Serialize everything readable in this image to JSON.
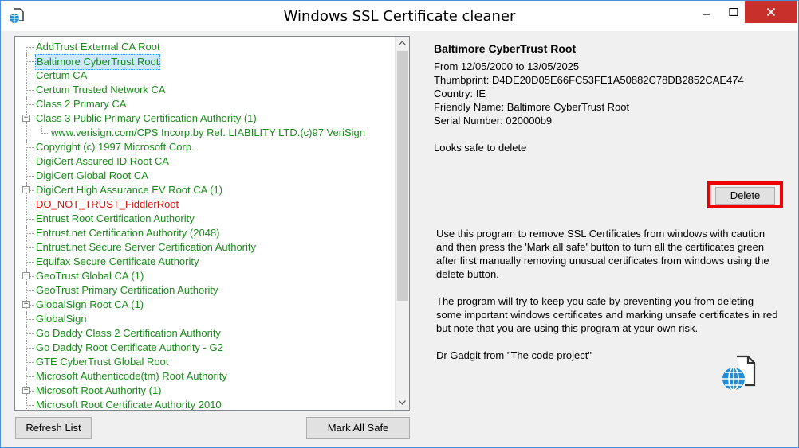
{
  "window": {
    "title": "Windows SSL Certificate cleaner"
  },
  "tree": {
    "items": [
      {
        "label": "AddTrust External CA Root",
        "color": "green",
        "expander": "",
        "level": 0
      },
      {
        "label": "Baltimore CyberTrust Root",
        "color": "green",
        "expander": "",
        "level": 0,
        "selected": true
      },
      {
        "label": "Certum CA",
        "color": "green",
        "expander": "",
        "level": 0
      },
      {
        "label": "Certum Trusted Network CA",
        "color": "green",
        "expander": "",
        "level": 0
      },
      {
        "label": "Class 2 Primary CA",
        "color": "green",
        "expander": "",
        "level": 0
      },
      {
        "label": "Class 3 Public Primary Certification Authority (1)",
        "color": "green",
        "expander": "−",
        "level": 0
      },
      {
        "label": "www.verisign.com/CPS Incorp.by Ref. LIABILITY LTD.(c)97 VeriSign",
        "color": "green",
        "expander": "",
        "level": 1
      },
      {
        "label": "Copyright (c) 1997 Microsoft Corp.",
        "color": "green",
        "expander": "",
        "level": 0
      },
      {
        "label": "DigiCert Assured ID Root CA",
        "color": "green",
        "expander": "",
        "level": 0
      },
      {
        "label": "DigiCert Global Root CA",
        "color": "green",
        "expander": "",
        "level": 0
      },
      {
        "label": "DigiCert High Assurance EV Root CA (1)",
        "color": "green",
        "expander": "+",
        "level": 0
      },
      {
        "label": "DO_NOT_TRUST_FiddlerRoot",
        "color": "red",
        "expander": "",
        "level": 0
      },
      {
        "label": "Entrust Root Certification Authority",
        "color": "green",
        "expander": "",
        "level": 0
      },
      {
        "label": "Entrust.net Certification Authority (2048)",
        "color": "green",
        "expander": "",
        "level": 0
      },
      {
        "label": "Entrust.net Secure Server Certification Authority",
        "color": "green",
        "expander": "",
        "level": 0
      },
      {
        "label": "Equifax Secure Certificate Authority",
        "color": "green",
        "expander": "",
        "level": 0
      },
      {
        "label": "GeoTrust Global CA (1)",
        "color": "green",
        "expander": "+",
        "level": 0
      },
      {
        "label": "GeoTrust Primary Certification Authority",
        "color": "green",
        "expander": "",
        "level": 0
      },
      {
        "label": "GlobalSign Root CA (1)",
        "color": "green",
        "expander": "+",
        "level": 0
      },
      {
        "label": "GlobalSign",
        "color": "green",
        "expander": "",
        "level": 0
      },
      {
        "label": "Go Daddy Class 2 Certification Authority",
        "color": "green",
        "expander": "",
        "level": 0
      },
      {
        "label": "Go Daddy Root Certificate Authority - G2",
        "color": "green",
        "expander": "",
        "level": 0
      },
      {
        "label": "GTE CyberTrust Global Root",
        "color": "green",
        "expander": "",
        "level": 0
      },
      {
        "label": "Microsoft Authenticode(tm) Root Authority",
        "color": "green",
        "expander": "",
        "level": 0
      },
      {
        "label": "Microsoft Root Authority (1)",
        "color": "green",
        "expander": "+",
        "level": 0
      },
      {
        "label": "Microsoft Root Certificate Authority 2010",
        "color": "green",
        "expander": "",
        "level": 0
      }
    ]
  },
  "buttons": {
    "refresh": "Refresh List",
    "mark_all_safe": "Mark All Safe",
    "delete": "Delete"
  },
  "details": {
    "name": "Baltimore CyberTrust Root",
    "validity": "From 12/05/2000 to 13/05/2025",
    "thumbprint": "Thumbprint: D4DE20D05E66FC53FE1A50882C78DB2852CAE474",
    "country": "Country: IE",
    "friendly_name": "Friendly Name: Baltimore CyberTrust Root",
    "serial": "Serial Number: 020000b9",
    "note": "Looks safe to delete"
  },
  "help": {
    "p1": "Use this program to remove SSL Certificates from windows with caution and then press the 'Mark all safe' button to turn all the certificates green after first manually removing unusual certificates from windows using the delete button.",
    "p2": "The program will try to keep you safe by preventing you from deleting some important windows certificates and marking unsafe certificates in red but note that you are using this program at your own risk.",
    "p3": "Dr Gadgit from \"The code project\""
  },
  "colors": {
    "green": "#1a8a1a",
    "red": "#e01010",
    "close_button": "#c7302b",
    "highlight_border": "#ee0000"
  },
  "icons": {
    "app": "globe-document-icon",
    "minimize": "minimize-icon",
    "maximize": "maximize-icon",
    "close": "close-icon",
    "scroll_up": "scroll-up-arrow-icon",
    "scroll_down": "scroll-down-arrow-icon",
    "logo": "globe-document-icon"
  }
}
